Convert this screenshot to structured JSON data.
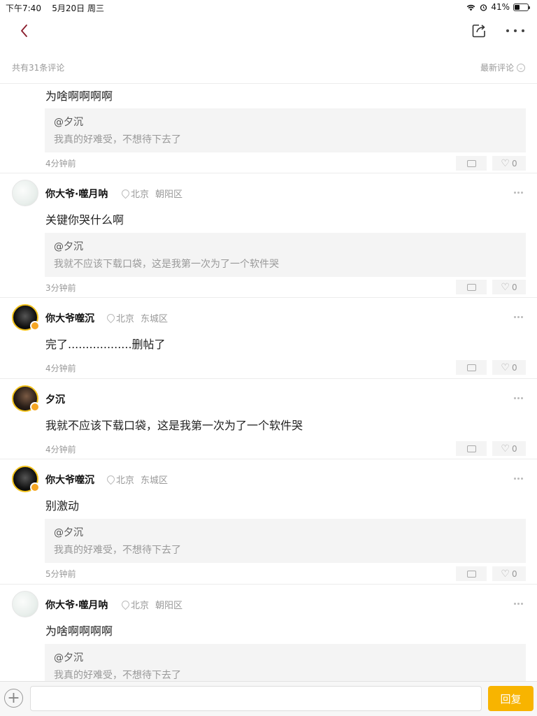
{
  "status_bar": {
    "time": "下午7:40",
    "date": "5月20日 周三",
    "battery": "41%",
    "battery_level": 0.41
  },
  "header": {
    "comment_count": "共有31条评论",
    "sort_label": "最新评论",
    "sort_icon": "chevron-down-icon"
  },
  "comments": [
    {
      "text": "为啥啊啊啊啊",
      "quote_user": "@夕沉",
      "quote_text": "我真的好难受，不想待下去了",
      "time": "4分钟前",
      "likes": "0"
    },
    {
      "name": "你大爷·噬月呐",
      "loc_city": "北京",
      "loc_district": "朝阳区",
      "text": "关键你哭什么啊",
      "quote_user": "@夕沉",
      "quote_text": "我就不应该下载口袋，这是我第一次为了一个软件哭",
      "time": "3分钟前",
      "likes": "0"
    },
    {
      "name": "你大爷噬沉",
      "loc_city": "北京",
      "loc_district": "东城区",
      "text": "完了..................删帖了",
      "time": "4分钟前",
      "likes": "0"
    },
    {
      "name": "夕沉",
      "text": "我就不应该下载口袋，这是我第一次为了一个软件哭",
      "time": "4分钟前",
      "likes": "0"
    },
    {
      "name": "你大爷噬沉",
      "loc_city": "北京",
      "loc_district": "东城区",
      "text": "别激动",
      "quote_user": "@夕沉",
      "quote_text": "我真的好难受，不想待下去了",
      "time": "5分钟前",
      "likes": "0"
    },
    {
      "name": "你大爷·噬月呐",
      "loc_city": "北京",
      "loc_district": "朝阳区",
      "text": "为啥啊啊啊啊",
      "quote_user": "@夕沉",
      "quote_text": "我真的好难受，不想待下去了"
    }
  ],
  "bottom_bar": {
    "input_placeholder": "",
    "send_label": "回复"
  },
  "colors": {
    "accent": "#f8b400",
    "badge": "#f5a623",
    "avatar_ring": "#f2c21b"
  }
}
